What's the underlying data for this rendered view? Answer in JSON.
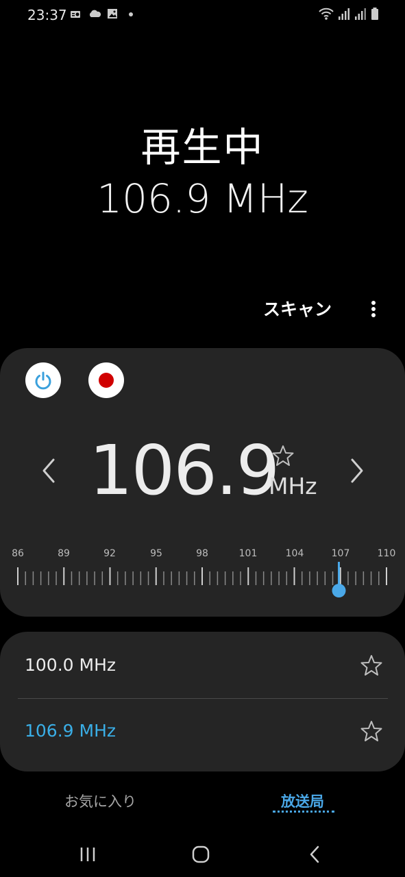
{
  "status_bar": {
    "time": "23:37",
    "left_icons": [
      "radio-icon",
      "cloud-icon",
      "gallery-icon",
      "notification-dot-icon"
    ],
    "right_icons": [
      "wifi-icon",
      "signal-icon",
      "signal-icon",
      "battery-icon"
    ]
  },
  "now_playing": {
    "status": "再生中",
    "frequency": "106.9 MHz"
  },
  "toolbar": {
    "scan_label": "スキャン",
    "more_icon": "more-vertical-icon"
  },
  "tuner": {
    "frequency": "106.9",
    "unit": "MHz",
    "power_icon": "power-icon",
    "record_icon": "record-icon",
    "favorite_icon": "star-outline-icon",
    "scale_labels": [
      "86",
      "89",
      "92",
      "95",
      "98",
      "101",
      "104",
      "107",
      "110"
    ],
    "scale_min": 86,
    "scale_max": 110,
    "current_value": 106.9,
    "colors": {
      "accent": "#4aa8e8",
      "record": "#d00000"
    }
  },
  "stations": [
    {
      "label": "100.0 MHz",
      "active": false
    },
    {
      "label": "106.9 MHz",
      "active": true
    }
  ],
  "tabs": {
    "favorites": "お気に入り",
    "stations": "放送局"
  },
  "colors": {
    "background": "#000000",
    "card": "#252525",
    "accent": "#4aa8e8"
  }
}
